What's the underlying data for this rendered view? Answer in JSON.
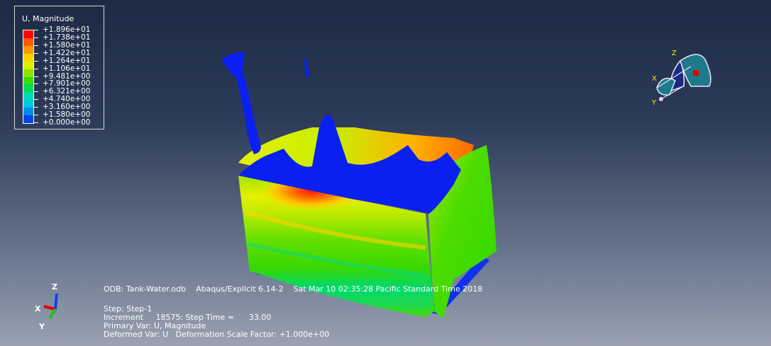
{
  "legend": {
    "title": "U, Magnitude",
    "entries": [
      {
        "label": "+1.896e+01",
        "color": "#ff0000"
      },
      {
        "label": "+1.738e+01",
        "color": "#ff5a00"
      },
      {
        "label": "+1.580e+01",
        "color": "#ff9a00"
      },
      {
        "label": "+1.422e+01",
        "color": "#ffd200"
      },
      {
        "label": "+1.264e+01",
        "color": "#dcf000"
      },
      {
        "label": "+1.106e+01",
        "color": "#8ee400"
      },
      {
        "label": "+9.481e+00",
        "color": "#3cdc00"
      },
      {
        "label": "+7.901e+00",
        "color": "#00dc5a"
      },
      {
        "label": "+6.321e+00",
        "color": "#00dcae"
      },
      {
        "label": "+4.740e+00",
        "color": "#00c8e6"
      },
      {
        "label": "+3.160e+00",
        "color": "#008cf0"
      },
      {
        "label": "+1.580e+00",
        "color": "#0046f0"
      },
      {
        "label": "+0.000e+00",
        "color": "#0000f0"
      }
    ]
  },
  "info": {
    "line1": "ODB: Tank-Water.odb    Abaqus/Explicit 6.14-2    Sat Mar 10 02:35:28 Pacific Standard Time 2018",
    "line2": "Step: Step-1",
    "line3": "Increment     18575: Step Time =      33.00",
    "line4": "Primary Var: U, Magnitude",
    "line5": "Deformed Var: U   Deformation Scale Factor: +1.000e+00"
  },
  "triad": {
    "x": "X",
    "y": "Y",
    "z": "Z"
  },
  "view_cube": {
    "x": "X",
    "y": "Y",
    "z": "Z"
  },
  "colors": {
    "background_top": "#1c2a44",
    "background_bottom": "#9aa2b2"
  }
}
